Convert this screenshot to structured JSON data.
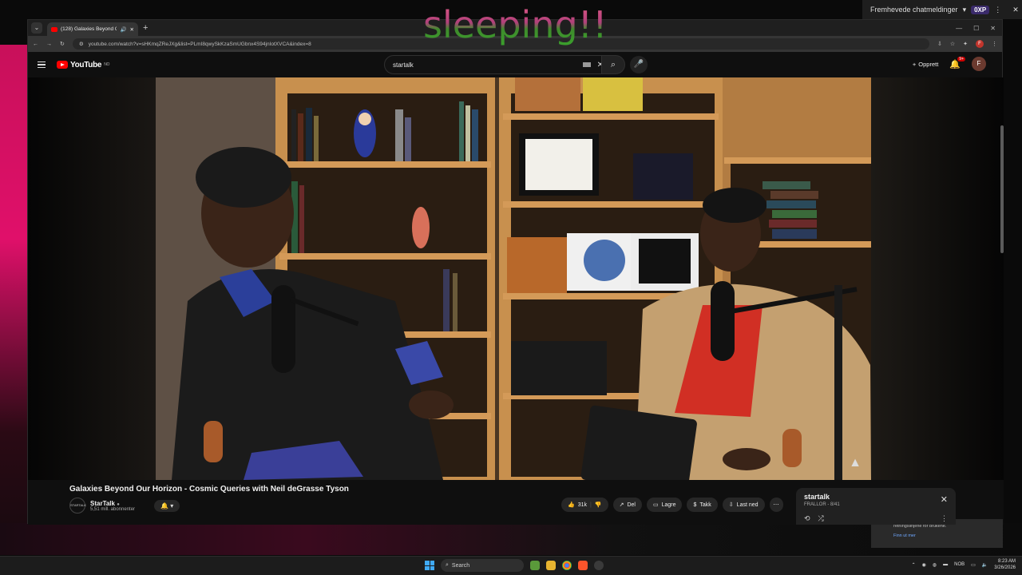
{
  "overlay": {
    "text": "sleeping!!"
  },
  "chat_panel": {
    "label": "Fremhevede chatmeldinger",
    "badge": "0XP"
  },
  "browser": {
    "tab_title": "(128) Galaxies Beyond Ou",
    "url": "youtube.com/watch?v=sHKmqZReJXg&list=PLmI8qwySkKzaSmUGbnx4S94jnIotXVCA&index=8"
  },
  "youtube": {
    "logo_text": "YouTube",
    "logo_region": "NO",
    "search_value": "startalk",
    "create_label": "Opprett",
    "notif_count": "9+",
    "avatar_letter": "F"
  },
  "video": {
    "title": "Galaxies Beyond Our Horizon - Cosmic Queries with Neil deGrasse Tyson",
    "channel_name": "StarTalk",
    "channel_avatar": "STARTALK",
    "subscribers": "5,51 mill. abonnenter",
    "likes": "31k",
    "share": "Del",
    "save": "Lagre",
    "thanks": "Takk",
    "download": "Last ned"
  },
  "playlist": {
    "title": "startalk",
    "subtitle": "FRALLOR - 8/41"
  },
  "notification": {
    "text": "retningslinjene for brukene.",
    "link": "Finn ut mer"
  },
  "taskbar": {
    "search_placeholder": "Search",
    "lang": "NOB",
    "time": "8:23 AM",
    "date": "3/26/2026"
  }
}
